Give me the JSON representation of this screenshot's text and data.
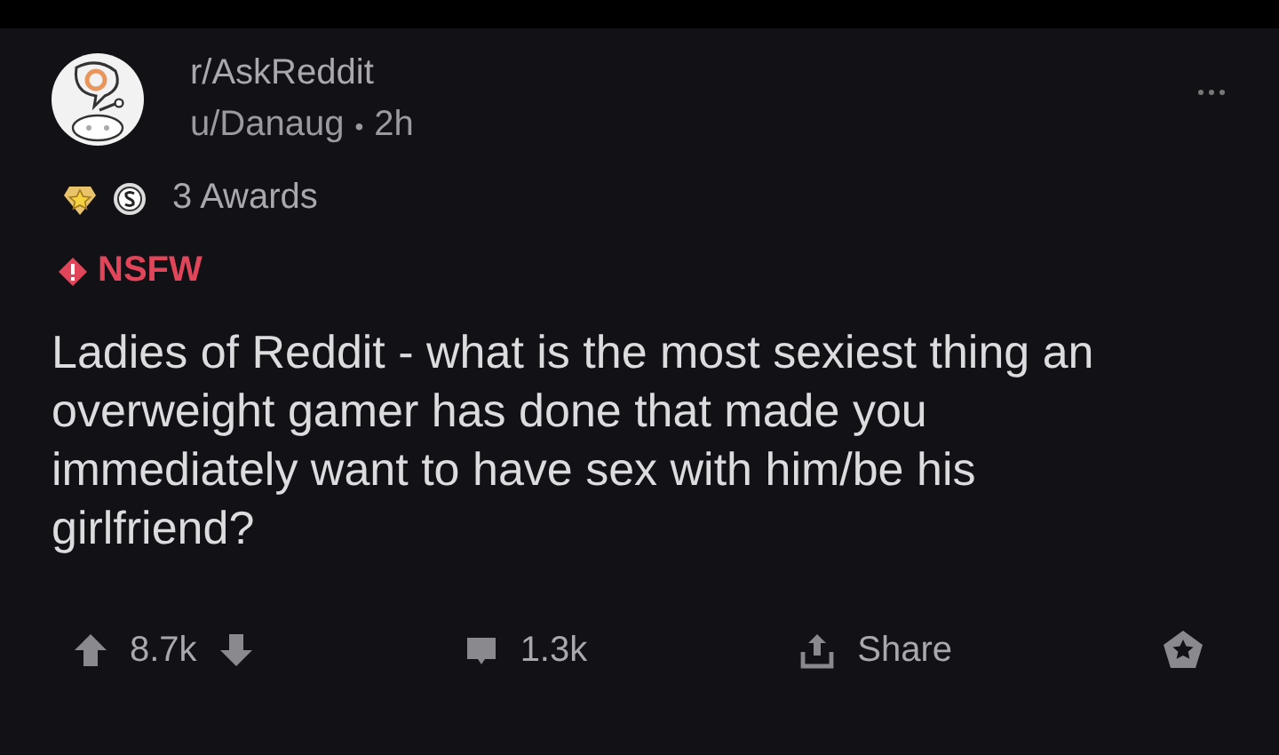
{
  "post": {
    "subreddit": "r/AskReddit",
    "author": "u/Danaug",
    "separator": "•",
    "age": "2h",
    "awards": "3 Awards",
    "tag": "NSFW",
    "title": "Ladies of Reddit - what is the most sexiest thing an overweight gamer has done that made you immediately want to have sex with him/be his girlfriend?"
  },
  "actions": {
    "score": "8.7k",
    "comments": "1.3k",
    "share": "Share"
  }
}
